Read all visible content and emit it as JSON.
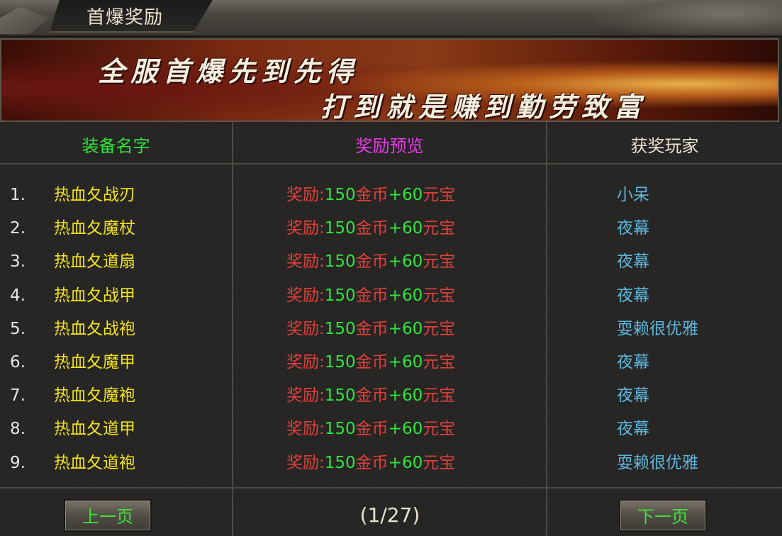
{
  "window": {
    "title": "首爆奖励"
  },
  "banner": {
    "line1": "全服首爆先到先得",
    "line2": "打到就是赚到勤劳致富"
  },
  "table": {
    "headers": {
      "item": "装备名字",
      "reward": "奖励预览",
      "player": "获奖玩家"
    },
    "rows": [
      {
        "num": "1.",
        "item": "热血夂战刃",
        "reward_prefix": "奖励:",
        "gold": "150",
        "gold_unit": "金币",
        "plus": "+",
        "yb": "60",
        "yb_unit": "元宝",
        "player": "小呆"
      },
      {
        "num": "2.",
        "item": "热血夂魔杖",
        "reward_prefix": "奖励:",
        "gold": "150",
        "gold_unit": "金币",
        "plus": "+",
        "yb": "60",
        "yb_unit": "元宝",
        "player": "夜幕"
      },
      {
        "num": "3.",
        "item": "热血夂道扇",
        "reward_prefix": "奖励:",
        "gold": "150",
        "gold_unit": "金币",
        "plus": "+",
        "yb": "60",
        "yb_unit": "元宝",
        "player": "夜幕"
      },
      {
        "num": "4.",
        "item": "热血夂战甲",
        "reward_prefix": "奖励:",
        "gold": "150",
        "gold_unit": "金币",
        "plus": "+",
        "yb": "60",
        "yb_unit": "元宝",
        "player": "夜幕"
      },
      {
        "num": "5.",
        "item": "热血夂战袍",
        "reward_prefix": "奖励:",
        "gold": "150",
        "gold_unit": "金币",
        "plus": "+",
        "yb": "60",
        "yb_unit": "元宝",
        "player": "耍赖很优雅"
      },
      {
        "num": "6.",
        "item": "热血夂魔甲",
        "reward_prefix": "奖励:",
        "gold": "150",
        "gold_unit": "金币",
        "plus": "+",
        "yb": "60",
        "yb_unit": "元宝",
        "player": "夜幕"
      },
      {
        "num": "7.",
        "item": "热血夂魔袍",
        "reward_prefix": "奖励:",
        "gold": "150",
        "gold_unit": "金币",
        "plus": "+",
        "yb": "60",
        "yb_unit": "元宝",
        "player": "夜幕"
      },
      {
        "num": "8.",
        "item": "热血夂道甲",
        "reward_prefix": "奖励:",
        "gold": "150",
        "gold_unit": "金币",
        "plus": "+",
        "yb": "60",
        "yb_unit": "元宝",
        "player": "夜幕"
      },
      {
        "num": "9.",
        "item": "热血夂道袍",
        "reward_prefix": "奖励:",
        "gold": "150",
        "gold_unit": "金币",
        "plus": "+",
        "yb": "60",
        "yb_unit": "元宝",
        "player": "耍赖很优雅"
      }
    ]
  },
  "pagination": {
    "prev_label": "上一页",
    "next_label": "下一页",
    "page_text": "(1/27)"
  },
  "colors": {
    "header_item": "#2ee63b",
    "header_reward": "#e83ce8",
    "header_player": "#e8e2cf",
    "item_name": "#f2e21b",
    "reward_red": "#e0403a",
    "reward_green": "#2ee63b",
    "player_name": "#5fb6dc"
  }
}
